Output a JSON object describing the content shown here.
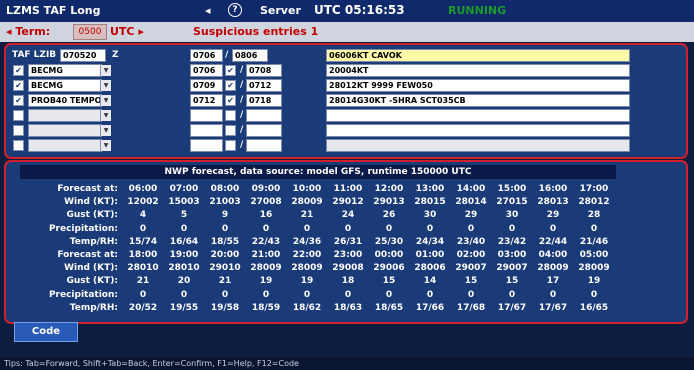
{
  "titlebar": {
    "title": "LZMS TAF Long",
    "nav_arrow": "◂",
    "help": "?",
    "server_label": "Server",
    "utc_label": "UTC 05:16:53",
    "status": "RUNNING"
  },
  "termbar": {
    "term_label": "◂ Term:",
    "term_value": "0500",
    "term_zone": "UTC ▸",
    "suspicious": "Suspicious entries   1"
  },
  "taf": {
    "header_label": "TAF LZIB",
    "issue_time": "070520",
    "z": "Z",
    "valid_from": "0706",
    "valid_to": "0806",
    "base_text": "06006KT CAVOK",
    "rows": [
      {
        "checked": true,
        "type": "BECMG",
        "from": "0706",
        "to_checked": true,
        "to": "0708",
        "text": "20004KT"
      },
      {
        "checked": true,
        "type": "BECMG",
        "from": "0709",
        "to_checked": true,
        "to": "0712",
        "text": "28012KT 9999 FEW050"
      },
      {
        "checked": true,
        "type": "PROB40 TEMPO",
        "from": "0712",
        "to_checked": true,
        "to": "0718",
        "text": "28014G30KT -SHRA SCT035CB"
      },
      {
        "checked": false,
        "type": "",
        "from": "",
        "to_checked": false,
        "to": "",
        "text": ""
      },
      {
        "checked": false,
        "type": "",
        "from": "",
        "to_checked": false,
        "to": "",
        "text": ""
      },
      {
        "checked": false,
        "type": "",
        "from": "",
        "to_checked": false,
        "to": "",
        "text": ""
      }
    ]
  },
  "nwp": {
    "header": "NWP forecast, data source: model GFS, runtime 150000 UTC",
    "blocks": [
      {
        "labels": [
          "Forecast at:",
          "Wind (KT):",
          "Gust (KT):",
          "Precipitation:",
          "Temp/RH:"
        ],
        "rows": [
          [
            "06:00",
            "07:00",
            "08:00",
            "09:00",
            "10:00",
            "11:00",
            "12:00",
            "13:00",
            "14:00",
            "15:00",
            "16:00",
            "17:00"
          ],
          [
            "12002",
            "15003",
            "21003",
            "27008",
            "28009",
            "29012",
            "29013",
            "28015",
            "28014",
            "27015",
            "28013",
            "28012"
          ],
          [
            "4",
            "5",
            "9",
            "16",
            "21",
            "24",
            "26",
            "30",
            "29",
            "30",
            "29",
            "28"
          ],
          [
            "0",
            "0",
            "0",
            "0",
            "0",
            "0",
            "0",
            "0",
            "0",
            "0",
            "0",
            "0"
          ],
          [
            "15/74",
            "16/64",
            "18/55",
            "22/43",
            "24/36",
            "26/31",
            "25/30",
            "24/34",
            "23/40",
            "23/42",
            "22/44",
            "21/46"
          ]
        ]
      },
      {
        "labels": [
          "Forecast at:",
          "Wind (KT):",
          "Gust (KT):",
          "Precipitation:",
          "Temp/RH:"
        ],
        "rows": [
          [
            "18:00",
            "19:00",
            "20:00",
            "21:00",
            "22:00",
            "23:00",
            "00:00",
            "01:00",
            "02:00",
            "03:00",
            "04:00",
            "05:00"
          ],
          [
            "28010",
            "28010",
            "29010",
            "28009",
            "28009",
            "29008",
            "29006",
            "28006",
            "29007",
            "29007",
            "28009",
            "28009"
          ],
          [
            "21",
            "20",
            "21",
            "19",
            "19",
            "18",
            "15",
            "14",
            "15",
            "15",
            "17",
            "19"
          ],
          [
            "0",
            "0",
            "0",
            "0",
            "0",
            "0",
            "0",
            "0",
            "0",
            "0",
            "0",
            "0"
          ],
          [
            "20/52",
            "19/55",
            "19/58",
            "18/59",
            "18/62",
            "18/63",
            "18/65",
            "17/66",
            "17/68",
            "17/67",
            "17/67",
            "16/65"
          ]
        ]
      }
    ]
  },
  "code_button": "Code",
  "tips": "Tips: Tab=Forward, Shift+Tab=Back, Enter=Confirm, F1=Help, F12=Code",
  "colors": {
    "background": "#0d1d3f",
    "panel": "#1a3a78",
    "panel_border": "#d0202a",
    "highlight": "#fffaa8",
    "status_green": "#1c9a2c"
  }
}
